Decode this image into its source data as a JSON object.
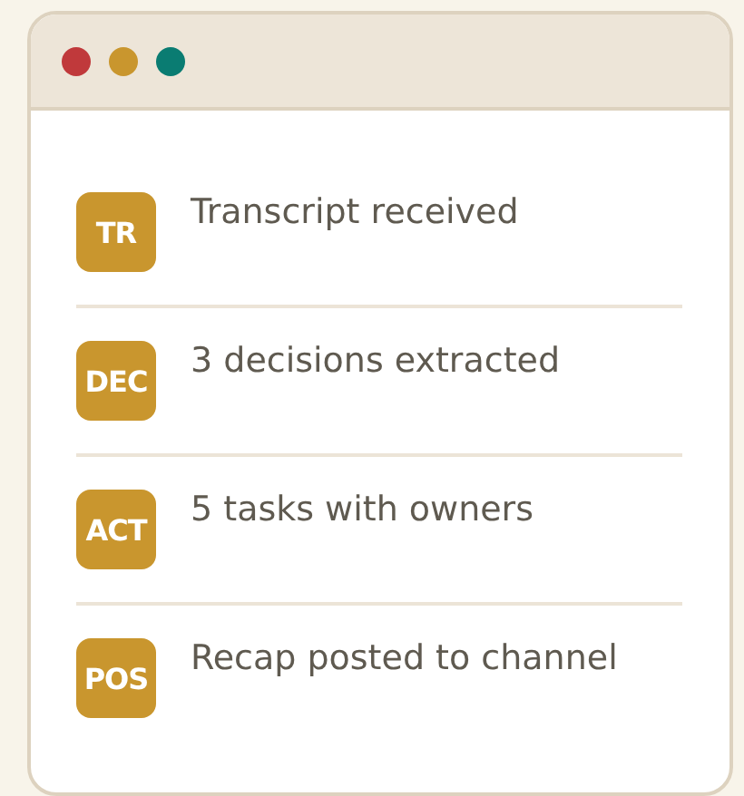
{
  "window": {
    "controls": [
      {
        "color": "#c0393b"
      },
      {
        "color": "#c9962e"
      },
      {
        "color": "#0a7c72"
      }
    ]
  },
  "steps": [
    {
      "badge": "TR",
      "text": "Transcript received"
    },
    {
      "badge": "DEC",
      "text": "3 decisions extracted"
    },
    {
      "badge": "ACT",
      "text": "5 tasks with owners"
    },
    {
      "badge": "POS",
      "text": "Recap posted to channel"
    }
  ]
}
